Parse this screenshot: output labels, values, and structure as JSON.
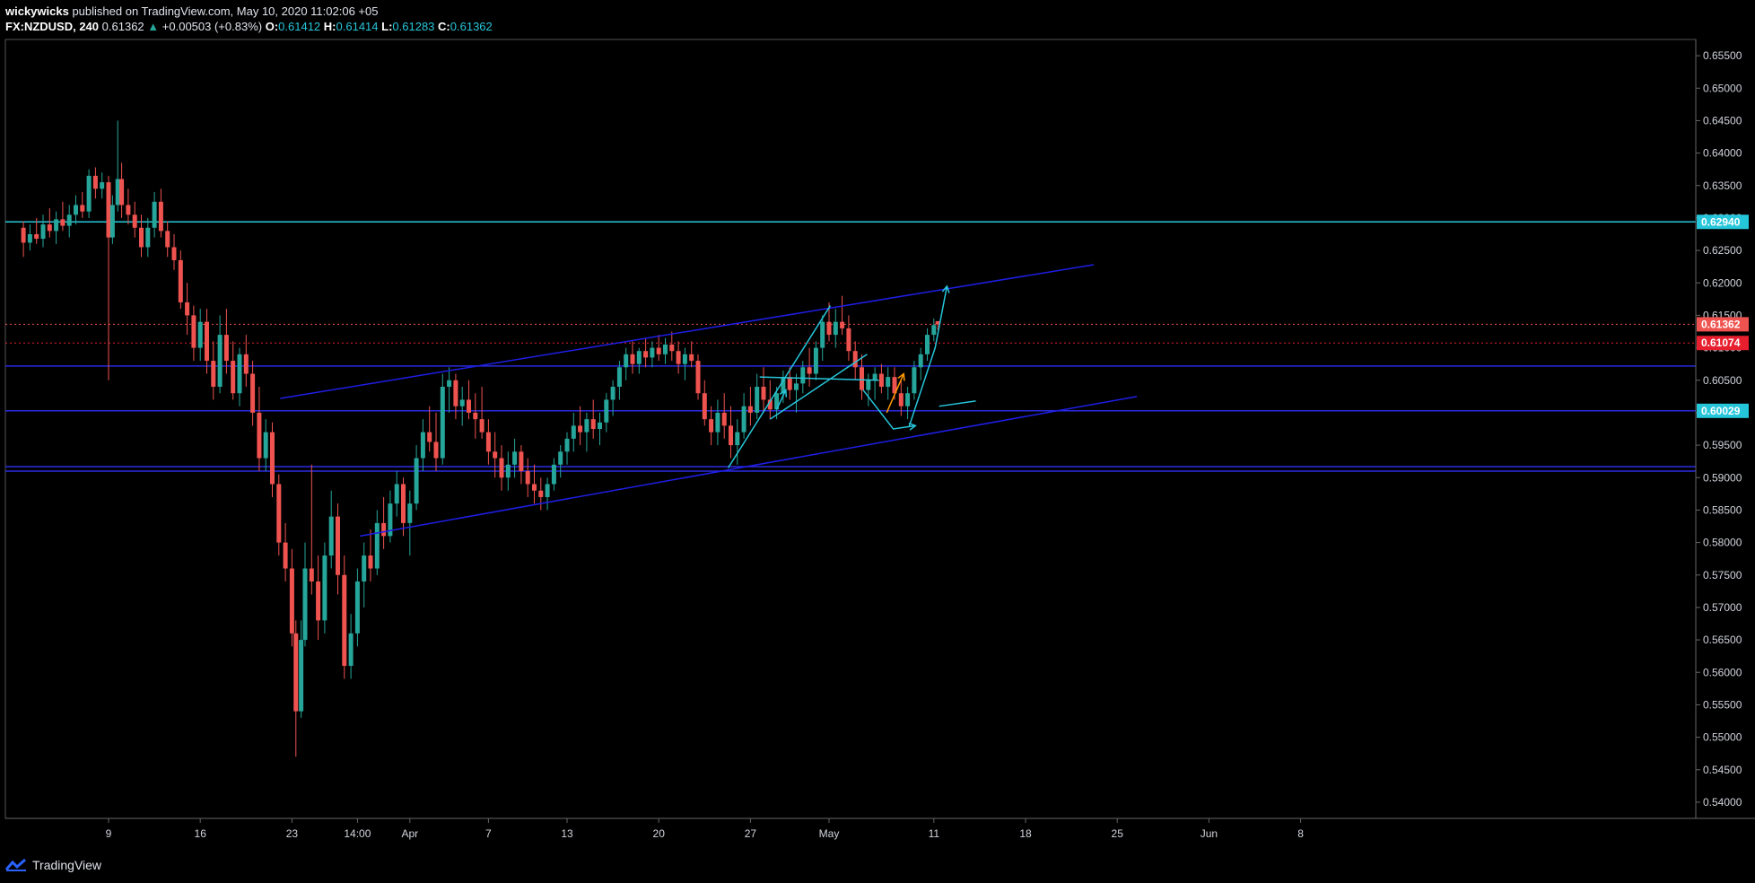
{
  "header": {
    "publisher": "wickywicks",
    "published_text": "published on TradingView.com, May 10, 2020 11:02:06 +05",
    "symbol": "FX:NZDUSD, 240",
    "last": "0.61362",
    "change": "+0.00503 (+0.83%)",
    "o_label": "O:",
    "o_value": "0.61412",
    "h_label": "H:",
    "h_value": "0.61414",
    "l_label": "L:",
    "l_value": "0.61283",
    "c_label": "C:",
    "c_value": "0.61362"
  },
  "footer": {
    "brand": "TradingView"
  },
  "colors": {
    "background": "#000000",
    "up_candle": "#26a69a",
    "down_candle": "#ef5350",
    "trendline": "#1e1ee6",
    "cyan_line": "#26c6da",
    "orange": "#ff9800",
    "price_label_red": "#ef5350",
    "price_label_darkred": "#e61e2d",
    "axis_text": "#d1d4dc"
  },
  "chart_data": {
    "type": "candlestick",
    "symbol": "FX:NZDUSD",
    "interval": "240",
    "ylim": [
      0.5375,
      0.6575
    ],
    "y_ticks": [
      "0.65500",
      "0.65000",
      "0.64500",
      "0.64000",
      "0.63500",
      "0.63000",
      "0.62500",
      "0.62000",
      "0.61500",
      "0.61000",
      "0.60500",
      "0.60000",
      "0.59500",
      "0.59000",
      "0.58500",
      "0.58000",
      "0.57500",
      "0.57000",
      "0.56500",
      "0.56000",
      "0.55500",
      "0.55000",
      "0.54500",
      "0.54000"
    ],
    "x_ticks": [
      "9",
      "16",
      "23",
      "14:00",
      "Apr",
      "7",
      "13",
      "20",
      "27",
      "May",
      "11",
      "18",
      "25",
      "Jun",
      "8"
    ],
    "x_tick_days": [
      0,
      7,
      14,
      19,
      23,
      29,
      35,
      42,
      49,
      55,
      63,
      70,
      77,
      84,
      91
    ],
    "price_labels": [
      {
        "value": 0.6294,
        "text": "0.62940",
        "color": "#26c6da"
      },
      {
        "value": 0.61362,
        "text": "0.61362",
        "color": "#ef5350"
      },
      {
        "value": 0.61074,
        "text": "0.61074",
        "color": "#e61e2d"
      },
      {
        "value": 0.60029,
        "text": "0.60029",
        "color": "#26c6da"
      }
    ],
    "horizontal_lines": [
      {
        "value": 0.6294,
        "color": "#26c6da",
        "style": "solid"
      },
      {
        "value": 0.61362,
        "color": "#ef5350",
        "style": "dotted"
      },
      {
        "value": 0.61074,
        "color": "#e61e2d",
        "style": "dotted"
      },
      {
        "value": 0.6072,
        "color": "#2a2ae0",
        "style": "solid"
      },
      {
        "value": 0.6003,
        "color": "#2a2ae0",
        "style": "solid"
      },
      {
        "value": 0.5917,
        "color": "#2a2ae0",
        "style": "solid"
      },
      {
        "value": 0.591,
        "color": "#2a2ae0",
        "style": "solid"
      }
    ],
    "trend_lines": [
      {
        "p1": [
          13.1,
          0.6022
        ],
        "p2": [
          75.2,
          0.6228
        ],
        "color": "#1e1ee6"
      },
      {
        "p1": [
          19.2,
          0.581
        ],
        "p2": [
          78.5,
          0.6025
        ],
        "color": "#1e1ee6"
      },
      {
        "p1": [
          47.3,
          0.5915
        ],
        "p2": [
          55.1,
          0.6165
        ],
        "color": "#26c6da"
      },
      {
        "p1": [
          50.5,
          0.599
        ],
        "p2": [
          57.9,
          0.609
        ],
        "color": "#26c6da"
      },
      {
        "p1": [
          49.7,
          0.6055
        ],
        "p2": [
          58.8,
          0.605
        ],
        "color": "#26c6da"
      },
      {
        "p1": [
          63.4,
          0.601
        ],
        "p2": [
          66.2,
          0.6018
        ],
        "color": "#26c6da"
      }
    ],
    "arrows": [
      {
        "points": [
          [
            57.6,
            0.6035
          ],
          [
            59.9,
            0.5975
          ],
          [
            61.6,
            0.598
          ]
        ],
        "color": "#26c6da"
      },
      {
        "points": [
          [
            61.1,
            0.5978
          ],
          [
            63.1,
            0.61
          ],
          [
            64.0,
            0.6195
          ]
        ],
        "color": "#26c6da"
      },
      {
        "points": [
          [
            59.4,
            0.6
          ],
          [
            60.7,
            0.606
          ]
        ],
        "color": "#ff9800"
      },
      {
        "points": [
          [
            51.0,
            0.6005
          ],
          [
            51.7,
            0.6035
          ]
        ],
        "color": "#26c6da"
      }
    ],
    "candles": [
      [
        -6.5,
        0.6285,
        0.6295,
        0.624,
        0.6262
      ],
      [
        -6.0,
        0.6262,
        0.629,
        0.625,
        0.6275
      ],
      [
        -5.5,
        0.6275,
        0.63,
        0.626,
        0.6268
      ],
      [
        -5.0,
        0.6268,
        0.6305,
        0.6255,
        0.629
      ],
      [
        -4.5,
        0.629,
        0.6315,
        0.627,
        0.628
      ],
      [
        -4.0,
        0.628,
        0.631,
        0.626,
        0.6298
      ],
      [
        -3.5,
        0.6298,
        0.6325,
        0.628,
        0.6288
      ],
      [
        -3.0,
        0.6288,
        0.632,
        0.627,
        0.6305
      ],
      [
        -2.5,
        0.6305,
        0.6335,
        0.629,
        0.632
      ],
      [
        -2.0,
        0.632,
        0.634,
        0.63,
        0.631
      ],
      [
        -1.5,
        0.631,
        0.6375,
        0.63,
        0.6365
      ],
      [
        -1.0,
        0.6365,
        0.6378,
        0.633,
        0.6345
      ],
      [
        -0.5,
        0.6345,
        0.637,
        0.633,
        0.6355
      ],
      [
        0.0,
        0.6355,
        0.6365,
        0.605,
        0.627
      ],
      [
        0.3,
        0.627,
        0.6335,
        0.626,
        0.632
      ],
      [
        0.7,
        0.632,
        0.645,
        0.631,
        0.636
      ],
      [
        1.0,
        0.636,
        0.6385,
        0.63,
        0.632
      ],
      [
        1.5,
        0.632,
        0.6345,
        0.629,
        0.6305
      ],
      [
        2.0,
        0.6305,
        0.6325,
        0.627,
        0.6285
      ],
      [
        2.5,
        0.6285,
        0.6305,
        0.624,
        0.6255
      ],
      [
        3.0,
        0.6255,
        0.63,
        0.624,
        0.6285
      ],
      [
        3.5,
        0.6285,
        0.634,
        0.627,
        0.6325
      ],
      [
        4.0,
        0.6325,
        0.6345,
        0.627,
        0.628
      ],
      [
        4.5,
        0.628,
        0.6295,
        0.624,
        0.6255
      ],
      [
        5.0,
        0.6255,
        0.6275,
        0.622,
        0.6235
      ],
      [
        5.5,
        0.6235,
        0.625,
        0.616,
        0.617
      ],
      [
        6.0,
        0.617,
        0.62,
        0.612,
        0.615
      ],
      [
        6.5,
        0.615,
        0.6165,
        0.608,
        0.61
      ],
      [
        7.0,
        0.61,
        0.616,
        0.608,
        0.614
      ],
      [
        7.5,
        0.614,
        0.616,
        0.606,
        0.608
      ],
      [
        8.0,
        0.608,
        0.611,
        0.602,
        0.604
      ],
      [
        8.5,
        0.604,
        0.615,
        0.603,
        0.612
      ],
      [
        9.0,
        0.612,
        0.616,
        0.606,
        0.608
      ],
      [
        9.5,
        0.608,
        0.611,
        0.602,
        0.603
      ],
      [
        10.0,
        0.603,
        0.61,
        0.601,
        0.609
      ],
      [
        10.5,
        0.609,
        0.612,
        0.604,
        0.606
      ],
      [
        11.0,
        0.606,
        0.608,
        0.598,
        0.6
      ],
      [
        11.5,
        0.6,
        0.604,
        0.591,
        0.593
      ],
      [
        12.0,
        0.593,
        0.599,
        0.591,
        0.597
      ],
      [
        12.5,
        0.597,
        0.5985,
        0.587,
        0.589
      ],
      [
        13.0,
        0.589,
        0.5905,
        0.578,
        0.58
      ],
      [
        13.5,
        0.58,
        0.583,
        0.574,
        0.576
      ],
      [
        14.0,
        0.576,
        0.579,
        0.564,
        0.566
      ],
      [
        14.3,
        0.566,
        0.568,
        0.547,
        0.554
      ],
      [
        14.7,
        0.554,
        0.568,
        0.553,
        0.565
      ],
      [
        15.0,
        0.565,
        0.58,
        0.564,
        0.576
      ],
      [
        15.5,
        0.576,
        0.592,
        0.572,
        0.574
      ],
      [
        16.0,
        0.574,
        0.578,
        0.565,
        0.568
      ],
      [
        16.5,
        0.568,
        0.58,
        0.566,
        0.578
      ],
      [
        17.0,
        0.578,
        0.588,
        0.576,
        0.584
      ],
      [
        17.5,
        0.584,
        0.586,
        0.572,
        0.575
      ],
      [
        18.0,
        0.575,
        0.578,
        0.559,
        0.561
      ],
      [
        18.5,
        0.561,
        0.569,
        0.559,
        0.566
      ],
      [
        19.0,
        0.566,
        0.576,
        0.564,
        0.574
      ],
      [
        19.5,
        0.574,
        0.58,
        0.57,
        0.578
      ],
      [
        20.0,
        0.578,
        0.582,
        0.574,
        0.576
      ],
      [
        20.5,
        0.576,
        0.585,
        0.575,
        0.583
      ],
      [
        21.0,
        0.583,
        0.587,
        0.579,
        0.581
      ],
      [
        21.5,
        0.581,
        0.588,
        0.58,
        0.586
      ],
      [
        22.0,
        0.586,
        0.591,
        0.584,
        0.589
      ],
      [
        22.5,
        0.589,
        0.59,
        0.581,
        0.583
      ],
      [
        23.0,
        0.583,
        0.588,
        0.578,
        0.586
      ],
      [
        23.5,
        0.586,
        0.595,
        0.585,
        0.593
      ],
      [
        24.0,
        0.593,
        0.599,
        0.591,
        0.597
      ],
      [
        24.5,
        0.597,
        0.601,
        0.594,
        0.5955
      ],
      [
        25.0,
        0.5955,
        0.6,
        0.591,
        0.593
      ],
      [
        25.5,
        0.593,
        0.606,
        0.592,
        0.604
      ],
      [
        26.0,
        0.604,
        0.607,
        0.6,
        0.605
      ],
      [
        26.5,
        0.605,
        0.606,
        0.599,
        0.601
      ],
      [
        27.0,
        0.601,
        0.604,
        0.598,
        0.602
      ],
      [
        27.5,
        0.602,
        0.605,
        0.599,
        0.6
      ],
      [
        28.0,
        0.6,
        0.603,
        0.596,
        0.599
      ],
      [
        28.5,
        0.599,
        0.604,
        0.596,
        0.597
      ],
      [
        29.0,
        0.597,
        0.599,
        0.592,
        0.594
      ],
      [
        29.5,
        0.594,
        0.597,
        0.59,
        0.593
      ],
      [
        30.0,
        0.593,
        0.595,
        0.588,
        0.59
      ],
      [
        30.5,
        0.59,
        0.594,
        0.588,
        0.592
      ],
      [
        31.0,
        0.592,
        0.596,
        0.59,
        0.594
      ],
      [
        31.5,
        0.594,
        0.595,
        0.589,
        0.591
      ],
      [
        32.0,
        0.591,
        0.593,
        0.587,
        0.589
      ],
      [
        32.5,
        0.589,
        0.592,
        0.586,
        0.588
      ],
      [
        33.0,
        0.588,
        0.59,
        0.585,
        0.587
      ],
      [
        33.5,
        0.587,
        0.59,
        0.585,
        0.589
      ],
      [
        34.0,
        0.589,
        0.593,
        0.588,
        0.592
      ],
      [
        34.5,
        0.592,
        0.595,
        0.59,
        0.594
      ],
      [
        35.0,
        0.594,
        0.597,
        0.592,
        0.596
      ],
      [
        35.5,
        0.596,
        0.6,
        0.594,
        0.598
      ],
      [
        36.0,
        0.598,
        0.601,
        0.595,
        0.597
      ],
      [
        36.5,
        0.597,
        0.6,
        0.594,
        0.599
      ],
      [
        37.0,
        0.599,
        0.602,
        0.596,
        0.5975
      ],
      [
        37.5,
        0.5975,
        0.6,
        0.595,
        0.5985
      ],
      [
        38.0,
        0.5985,
        0.603,
        0.597,
        0.602
      ],
      [
        38.5,
        0.602,
        0.605,
        0.5995,
        0.604
      ],
      [
        39.0,
        0.604,
        0.608,
        0.602,
        0.607
      ],
      [
        39.5,
        0.607,
        0.61,
        0.605,
        0.609
      ],
      [
        40.0,
        0.609,
        0.611,
        0.606,
        0.6075
      ],
      [
        40.5,
        0.6075,
        0.61,
        0.606,
        0.6095
      ],
      [
        41.0,
        0.6095,
        0.6115,
        0.607,
        0.6085
      ],
      [
        41.5,
        0.6085,
        0.611,
        0.607,
        0.61
      ],
      [
        42.0,
        0.61,
        0.612,
        0.608,
        0.609
      ],
      [
        42.5,
        0.609,
        0.6115,
        0.6075,
        0.6105
      ],
      [
        43.0,
        0.6105,
        0.6125,
        0.608,
        0.6095
      ],
      [
        43.5,
        0.6095,
        0.611,
        0.606,
        0.6075
      ],
      [
        44.0,
        0.6075,
        0.61,
        0.605,
        0.609
      ],
      [
        44.5,
        0.609,
        0.611,
        0.607,
        0.608
      ],
      [
        45.0,
        0.608,
        0.609,
        0.602,
        0.603
      ],
      [
        45.5,
        0.603,
        0.605,
        0.598,
        0.599
      ],
      [
        46.0,
        0.599,
        0.601,
        0.595,
        0.597
      ],
      [
        46.5,
        0.597,
        0.602,
        0.595,
        0.6
      ],
      [
        47.0,
        0.6,
        0.603,
        0.596,
        0.598
      ],
      [
        47.5,
        0.598,
        0.601,
        0.593,
        0.595
      ],
      [
        48.0,
        0.595,
        0.599,
        0.592,
        0.597
      ],
      [
        48.5,
        0.597,
        0.603,
        0.596,
        0.601
      ],
      [
        49.0,
        0.601,
        0.604,
        0.598,
        0.6
      ],
      [
        49.5,
        0.6,
        0.606,
        0.599,
        0.604
      ],
      [
        50.0,
        0.604,
        0.607,
        0.6,
        0.602
      ],
      [
        50.5,
        0.602,
        0.605,
        0.599,
        0.6005
      ],
      [
        51.0,
        0.6005,
        0.604,
        0.599,
        0.603
      ],
      [
        51.5,
        0.603,
        0.6065,
        0.6015,
        0.6055
      ],
      [
        52.0,
        0.6055,
        0.607,
        0.602,
        0.6035
      ],
      [
        52.5,
        0.6035,
        0.606,
        0.6,
        0.6045
      ],
      [
        53.0,
        0.6045,
        0.608,
        0.603,
        0.607
      ],
      [
        53.5,
        0.607,
        0.61,
        0.604,
        0.606
      ],
      [
        54.0,
        0.606,
        0.611,
        0.605,
        0.61
      ],
      [
        54.5,
        0.61,
        0.615,
        0.608,
        0.614
      ],
      [
        55.0,
        0.614,
        0.617,
        0.611,
        0.612
      ],
      [
        55.5,
        0.612,
        0.616,
        0.61,
        0.614
      ],
      [
        56.0,
        0.614,
        0.618,
        0.612,
        0.613
      ],
      [
        56.5,
        0.613,
        0.615,
        0.608,
        0.6095
      ],
      [
        57.0,
        0.6095,
        0.611,
        0.605,
        0.607
      ],
      [
        57.5,
        0.607,
        0.609,
        0.602,
        0.6035
      ],
      [
        58.0,
        0.6035,
        0.606,
        0.601,
        0.605
      ],
      [
        58.5,
        0.605,
        0.607,
        0.602,
        0.606
      ],
      [
        59.0,
        0.606,
        0.6075,
        0.603,
        0.604
      ],
      [
        59.5,
        0.604,
        0.607,
        0.602,
        0.6055
      ],
      [
        60.0,
        0.6055,
        0.607,
        0.602,
        0.603
      ],
      [
        60.5,
        0.603,
        0.605,
        0.5995,
        0.601
      ],
      [
        61.0,
        0.601,
        0.604,
        0.599,
        0.603
      ],
      [
        61.5,
        0.603,
        0.608,
        0.602,
        0.607
      ],
      [
        62.0,
        0.607,
        0.61,
        0.605,
        0.609
      ],
      [
        62.5,
        0.609,
        0.613,
        0.608,
        0.612
      ],
      [
        63.0,
        0.612,
        0.6145,
        0.611,
        0.6135
      ],
      [
        63.3,
        0.6141,
        0.6141,
        0.6128,
        0.6136
      ]
    ]
  }
}
